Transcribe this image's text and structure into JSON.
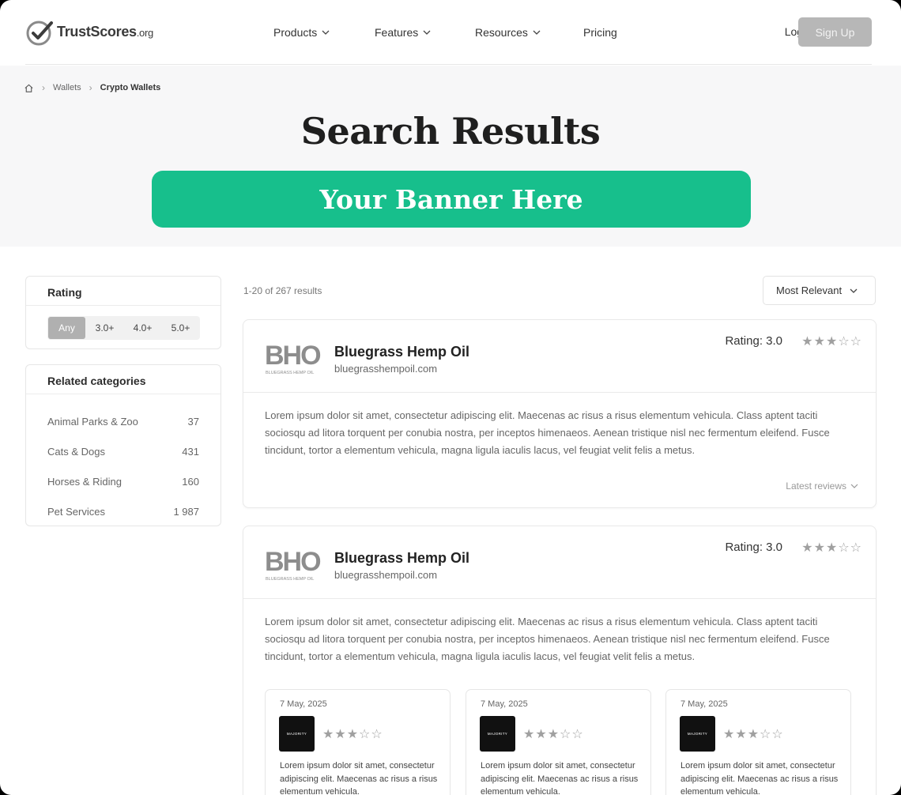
{
  "header": {
    "logo_main": "TrustScores",
    "logo_suffix": ".org",
    "nav": [
      {
        "label": "Products",
        "has_dropdown": true
      },
      {
        "label": "Features",
        "has_dropdown": true
      },
      {
        "label": "Resources",
        "has_dropdown": true
      },
      {
        "label": "Pricing",
        "has_dropdown": false
      }
    ],
    "login_label": "Login",
    "signup_label": "Sign Up"
  },
  "breadcrumb": {
    "icon": "home-icon",
    "items": [
      "Wallets",
      "Crypto Wallets"
    ]
  },
  "hero": {
    "title": "Search Results",
    "banner": "Your Banner Here"
  },
  "colors": {
    "banner": "#17bf8c",
    "signup_button": "#b7b7b7",
    "active_filter": "#b0b0b0",
    "star": "#a0a0a0"
  },
  "sidebar": {
    "rating": {
      "title": "Rating",
      "options": [
        "Any",
        "3.0+",
        "4.0+",
        "5.0+"
      ],
      "selected": "Any"
    },
    "categories": {
      "title": "Related categories",
      "items": [
        {
          "name": "Animal Parks & Zoo",
          "count": "37"
        },
        {
          "name": "Cats & Dogs",
          "count": "431"
        },
        {
          "name": "Horses & Riding",
          "count": "160"
        },
        {
          "name": "Pet Services",
          "count": "1 987"
        }
      ]
    }
  },
  "results": {
    "count_text": "1-20 of 267 results",
    "sort_label": "Most Relevant",
    "items": [
      {
        "logo_text": "BHO",
        "logo_subtext": "BLUEGRASS HEMP OIL",
        "name": "Bluegrass Hemp Oil",
        "url": "bluegrasshempoil.com",
        "rating_label": "Rating: 3.0",
        "rating": 3,
        "max_rating": 5,
        "description": "Lorem ipsum dolor sit amet, consectetur adipiscing elit. Maecenas ac risus a risus elementum vehicula. Class aptent taciti sociosqu ad litora torquent per conubia nostra, per inceptos himenaeos. Aenean tristique nisl nec fermentum eleifend. Fusce tincidunt, tortor a elementum vehicula, magna ligula iaculis lacus, vel feugiat velit felis a metus.",
        "latest_reviews_label": "Latest reviews"
      },
      {
        "logo_text": "BHO",
        "logo_subtext": "BLUEGRASS HEMP OIL",
        "name": "Bluegrass Hemp Oil",
        "url": "bluegrasshempoil.com",
        "rating_label": "Rating: 3.0",
        "rating": 3,
        "max_rating": 5,
        "description": "Lorem ipsum dolor sit amet, consectetur adipiscing elit. Maecenas ac risus a risus elementum vehicula. Class aptent taciti sociosqu ad litora torquent per conubia nostra, per inceptos himenaeos. Aenean tristique nisl nec fermentum eleifend. Fusce tincidunt, tortor a elementum vehicula, magna ligula iaculis lacus, vel feugiat velit felis a metus.",
        "reviews": [
          {
            "date": "7 May, 2025",
            "avatar_text": "MAJORITY",
            "rating": 3,
            "text": "Lorem ipsum dolor sit amet, consectetur adipiscing elit. Maecenas ac risus a risus elementum vehicula."
          },
          {
            "date": "7 May, 2025",
            "avatar_text": "MAJORITY",
            "rating": 3,
            "text": "Lorem ipsum dolor sit amet, consectetur adipiscing elit. Maecenas ac risus a risus elementum vehicula."
          },
          {
            "date": "7 May, 2025",
            "avatar_text": "MAJORITY",
            "rating": 3,
            "text": "Lorem ipsum dolor sit amet, consectetur adipiscing elit. Maecenas ac risus a risus elementum vehicula."
          }
        ]
      }
    ]
  }
}
